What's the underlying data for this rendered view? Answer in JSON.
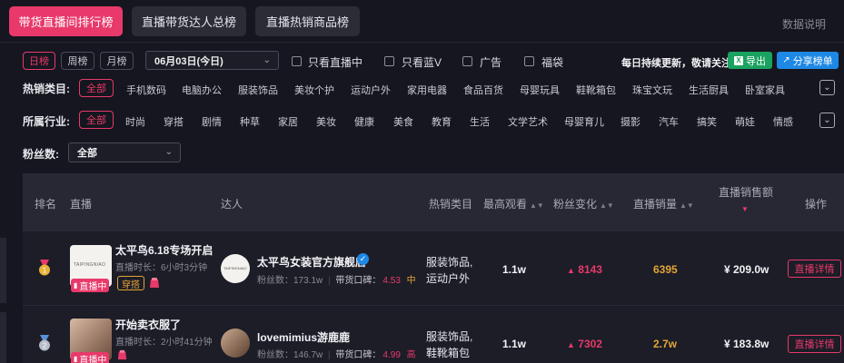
{
  "tabs": [
    {
      "label": "带货直播间排行榜",
      "active": true
    },
    {
      "label": "直播带货达人总榜",
      "active": false
    },
    {
      "label": "直播热销商品榜",
      "active": false
    }
  ],
  "data_note": "数据说明",
  "period_chips": [
    "日榜",
    "周榜",
    "月榜"
  ],
  "date_select": "06月03日(今日)",
  "filters": {
    "live_only": "只看直播中",
    "blue_v": "只看蓝V",
    "ads": "广告",
    "lucky_bag": "福袋"
  },
  "update_note": "每日持续更新，敬请关注",
  "export_label": "导出",
  "share_label": "分享榜单",
  "hot_category": {
    "label": "热销类目:",
    "items": [
      "全部",
      "手机数码",
      "电脑办公",
      "服装饰品",
      "美妆个护",
      "运动户外",
      "家用电器",
      "食品百货",
      "母婴玩具",
      "鞋靴箱包",
      "珠宝文玩",
      "生活厨具",
      "卧室家具"
    ]
  },
  "industry": {
    "label": "所属行业:",
    "items": [
      "全部",
      "时尚",
      "穿搭",
      "剧情",
      "种草",
      "家居",
      "美妆",
      "健康",
      "美食",
      "教育",
      "生活",
      "文学艺术",
      "母婴育儿",
      "摄影",
      "汽车",
      "搞笑",
      "萌娃",
      "情感"
    ]
  },
  "fans": {
    "label": "粉丝数:",
    "value": "全部"
  },
  "table": {
    "headers": {
      "rank": "排名",
      "live": "直播",
      "talent": "达人",
      "category": "热销类目",
      "max_viewers": "最高观看",
      "fan_change": "粉丝变化",
      "sales_volume": "直播销量",
      "sales_amount": "直播销售额",
      "action": "操作"
    },
    "rows": [
      {
        "rank": "1",
        "thumb_text": "TAIPINGNIAO",
        "title": "太平鸟6.18专场开启",
        "duration_label": "直播时长：",
        "duration": "6小时3分钟",
        "live_badge": "直播中",
        "tag": "穿搭",
        "talent_name": "太平鸟女装官方旗舰店",
        "fans_label": "粉丝数：",
        "fans": "173.1w",
        "reputation_label": "带货口碑：",
        "reputation": "4.53",
        "reputation_level": "中",
        "category_lines": [
          "服装饰品,",
          "运动户外"
        ],
        "max_viewers": "1.1w",
        "fan_change": "8143",
        "sales_volume": "6395",
        "sales_amount": "¥ 209.0w",
        "action": "直播详情"
      },
      {
        "rank": "2",
        "title": "开始卖衣服了",
        "duration_label": "直播时长：",
        "duration": "2小时41分钟",
        "live_badge": "直播中",
        "tag": "",
        "talent_name": "lovemimius游鹿鹿",
        "fans_label": "粉丝数：",
        "fans": "146.7w",
        "reputation_label": "带货口碑：",
        "reputation": "4.99",
        "reputation_level": "高",
        "category_lines": [
          "服装饰品,",
          "鞋靴箱包"
        ],
        "max_viewers": "1.1w",
        "fan_change": "7302",
        "sales_volume": "2.7w",
        "sales_amount": "¥ 183.8w",
        "action": "直播详情"
      }
    ]
  },
  "colors": {
    "accent": "#e8396a",
    "gold": "#e4a436",
    "green": "#1aa260",
    "blue": "#1e88e5"
  }
}
